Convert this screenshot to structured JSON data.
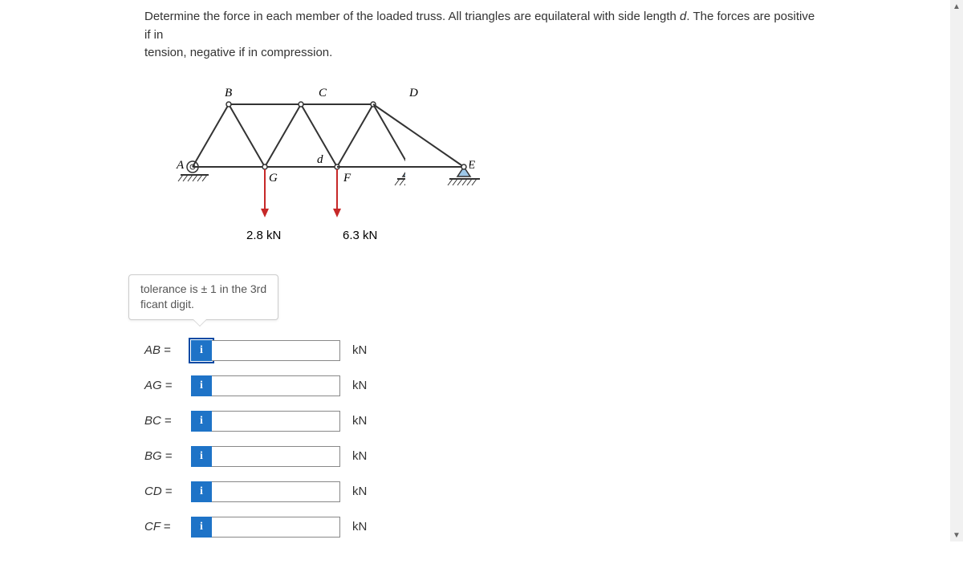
{
  "problem": {
    "line1_a": "Determine the force in each member of the loaded truss. All triangles are equilateral with side length ",
    "line1_b": ". The forces are positive if in",
    "line2": "tension, negative if in compression.",
    "d": "d"
  },
  "diagram": {
    "labels": {
      "A": "A",
      "B": "B",
      "C": "C",
      "D": "D",
      "E": "E",
      "F": "F",
      "G": "G",
      "d": "d"
    },
    "load_g": "2.8 kN",
    "load_f": "6.3 kN"
  },
  "tooltip": {
    "line1": "tolerance is ± 1 in the 3rd",
    "line2": "ficant digit."
  },
  "answers": [
    {
      "label": "AB",
      "unit": "kN",
      "focused": true
    },
    {
      "label": "AG",
      "unit": "kN",
      "focused": false
    },
    {
      "label": "BC",
      "unit": "kN",
      "focused": false
    },
    {
      "label": "BG",
      "unit": "kN",
      "focused": false
    },
    {
      "label": "CD",
      "unit": "kN",
      "focused": false
    },
    {
      "label": "CF",
      "unit": "kN",
      "focused": false
    }
  ],
  "chart_data": {
    "type": "diagram",
    "description": "Planar truss with nodes A,G,F,E on bottom chord and B,C,D on top chord. All triangles equilateral with side length d. Pin support at A (left), roller support at E (right). Downward point load 2.8 kN at G, downward point load 6.3 kN at F.",
    "nodes": [
      "A",
      "B",
      "C",
      "D",
      "E",
      "F",
      "G"
    ],
    "members": [
      "AB",
      "AG",
      "BG",
      "BC",
      "CG",
      "GF",
      "CF",
      "CD",
      "DF",
      "FE",
      "DE"
    ],
    "loads": [
      {
        "node": "G",
        "magnitude_kN": 2.8,
        "direction": "down"
      },
      {
        "node": "F",
        "magnitude_kN": 6.3,
        "direction": "down"
      }
    ],
    "supports": [
      {
        "node": "A",
        "type": "pin"
      },
      {
        "node": "E",
        "type": "roller"
      }
    ],
    "side_length_symbol": "d"
  }
}
